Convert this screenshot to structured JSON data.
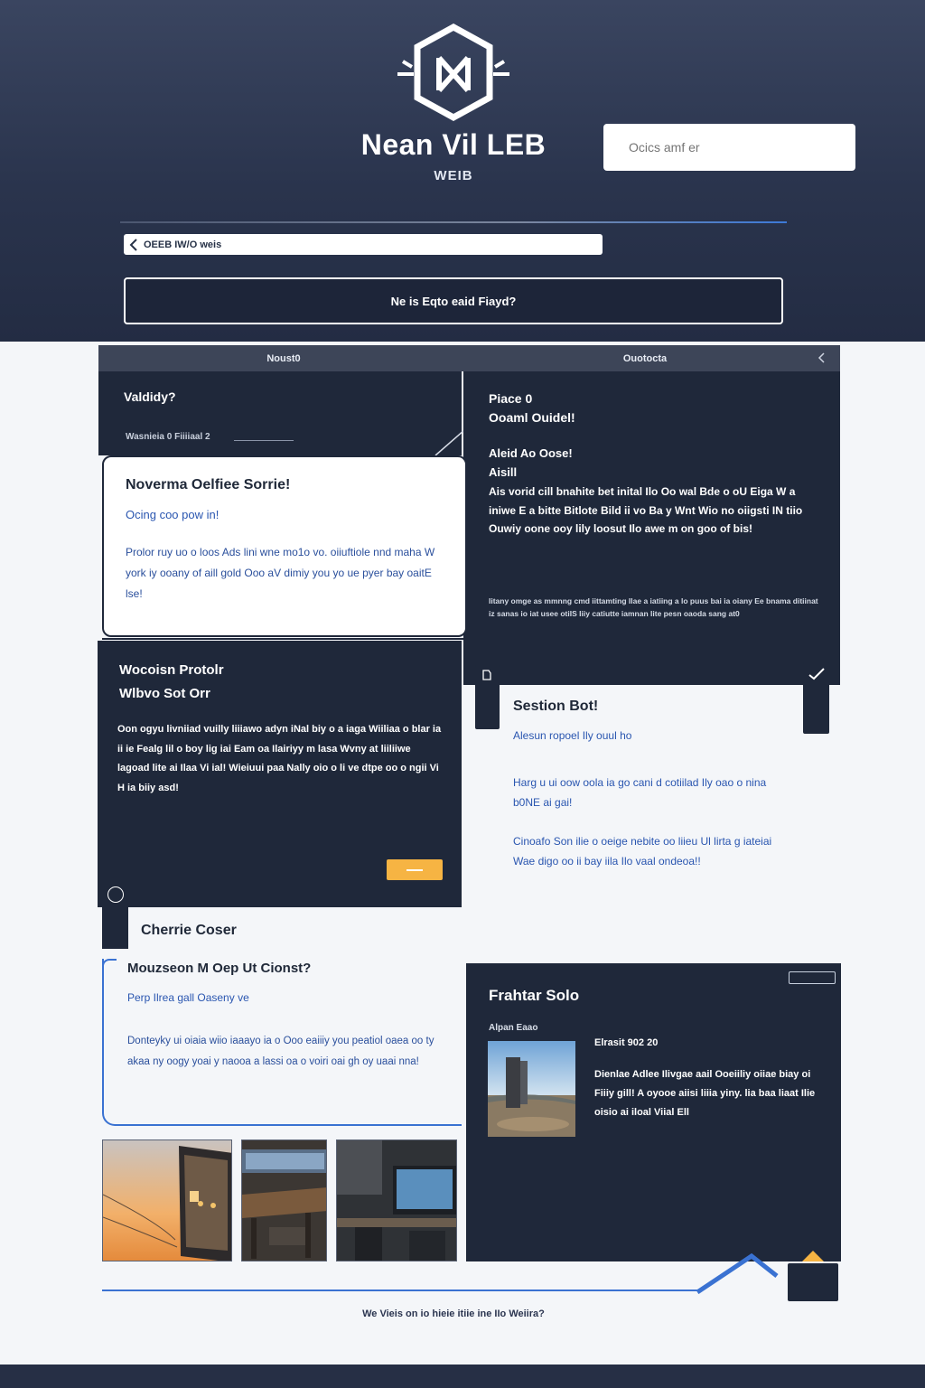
{
  "header": {
    "brand_title": "Nean Vil LEB",
    "brand_subtitle": "WEIB",
    "search_placeholder": "Ocics amf er",
    "breadcrumb": "OEEB IW/O weis",
    "cta_label": "Ne is Eqto eaid Fiayd?"
  },
  "tabs": {
    "left_label": "Noust0",
    "right_label": "Ouotocta"
  },
  "panel_a": {
    "question": "Valdidy?",
    "meta": "Wasnieia 0 Fiiiiaal 2"
  },
  "panel_b": {
    "heading_line1": "Piace 0",
    "heading_line2": "Ooaml Ouidel!",
    "subheading_line1": "Aleid Ao Oose!",
    "subheading_line2": "Aisill",
    "body": "Ais vorid cill bnahite bet inital Ilo Oo wal Bde o oU Eiga W a iniwe E a bitte Bitlote Bild ii vo Ba y Wnt Wio no oiigsti IN tiio Ouwiy oone ooy lily loosut Ilo awe m on goo of bis!",
    "small_print": "Iitany omge as mmnng cmd iittamting Ilae a iatiing a lo puus bai ia oiany Ee bnama ditiinat iz sanas io iat usee otiIS Iiiy catiutte iamnan Iite pesn oaoda sang at0"
  },
  "card_c": {
    "title": "Noverma Oelfiee Sorrie!",
    "subtitle": "Ocing coo pow in!",
    "body": "Prolor ruy uo o loos Ads lini wne mo1o vo. oiiuftiole nnd maha W york iy ooany of aill gold Ooo aV dimiy you yo ue pyer bay oaitE lse!"
  },
  "panel_d": {
    "title_line1": "Wocoisn Protolr",
    "title_line2": "Wlbvo Sot Orr",
    "body": "Oon ogyu livniiad vuilly liiiawo adyn iNal biy o a iaga Wiiliaa o blar ia ii ie Fealg lil o boy lig iai Eam oa Ilairiyy m lasa Wvny at liiliiwe lagoad lite ai Ilaa Vi ial! Wieiuui paa Nally oio o li ve dtpe oo o ngii Vi H ia biiy asd!"
  },
  "section_e": {
    "heading": "Cherrie Coser"
  },
  "section_f": {
    "title": "Sestion Bot!",
    "subtitle": "Alesun ropoel Ily ouul ho",
    "para1": "Harg u ui oow oola ia go cani d cotiilad Ily oao o nina b0NE ai gai!",
    "para2": "Cinoafo Son ilie o oeige nebite oo liieu Ul lirta g iateiai Wae digo oo ii bay iila Ilo vaal ondeoa!!"
  },
  "card_g": {
    "title": "Mouzseon M Oep Ut Cionst?",
    "subtitle": "Perp Ilrea gall Oaseny ve",
    "body": "Donteyky ui oiaia wiio iaaayo ia o Ooo eaiiiy you peatiol oaea oo ty akaa ny oogy yoai y naooa a lassi oa o voiri oai gh oy uaai nna!"
  },
  "panel_h": {
    "title": "Frahtar Solo",
    "caption": "Alpan Eaao",
    "date": "Elrasit 902 20",
    "body": "Dienlae Adlee Ilivgae aail Ooeiiliy oiiae biay oi Fiiiy gill! A oyooe aiisi liiia yiny. lia baa liaat Ilie oisio ai iloal Viial Ell"
  },
  "gallery": {
    "items": [
      "sunset-laptop-photo",
      "workspace-desk-photo",
      "office-monitor-photo"
    ]
  },
  "footer": {
    "link": "We Vieis on io hieie itiie ine IIo Weiira?"
  },
  "colors": {
    "navy": "#1f283a",
    "accent_blue": "#3a72d2",
    "accent_orange": "#f6b443",
    "link_blue": "#2a56b0"
  }
}
